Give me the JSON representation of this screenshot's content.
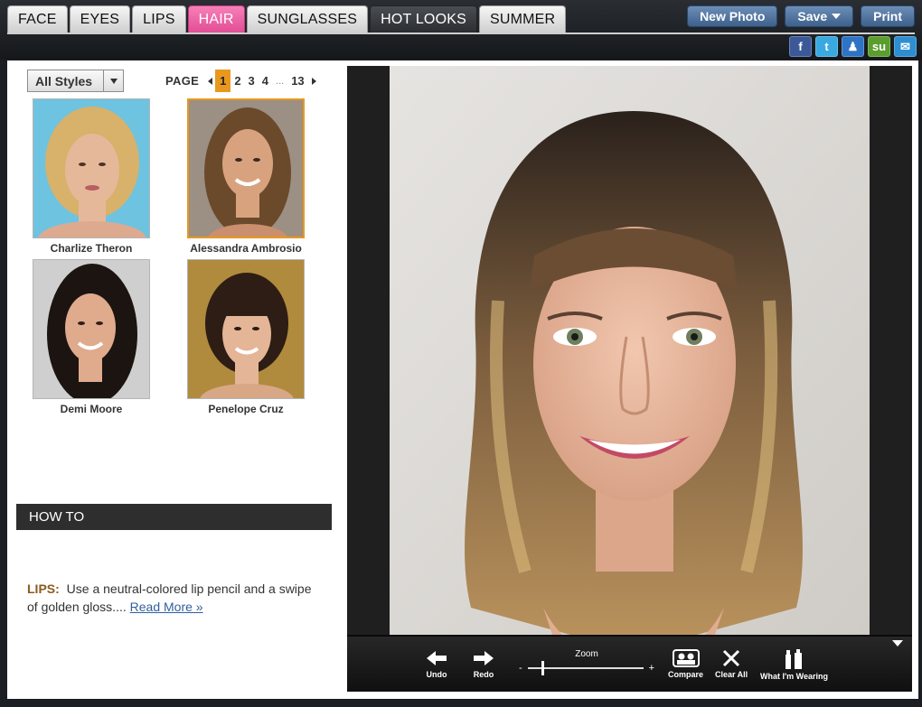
{
  "tabs": [
    {
      "label": "FACE",
      "state": "normal"
    },
    {
      "label": "EYES",
      "state": "normal"
    },
    {
      "label": "LIPS",
      "state": "normal"
    },
    {
      "label": "HAIR",
      "state": "active"
    },
    {
      "label": "SUNGLASSES",
      "state": "normal"
    },
    {
      "label": "HOT LOOKS",
      "state": "dark"
    },
    {
      "label": "SUMMER",
      "state": "normal"
    }
  ],
  "actions": {
    "new_photo": "New Photo",
    "save": "Save",
    "print": "Print"
  },
  "social": [
    {
      "icon": "facebook-icon",
      "glyph": "f",
      "color": "#3b5998"
    },
    {
      "icon": "twitter-icon",
      "glyph": "t",
      "color": "#39a9e0"
    },
    {
      "icon": "myspace-icon",
      "glyph": "♟",
      "color": "#2f74c4"
    },
    {
      "icon": "stumbleupon-icon",
      "glyph": "su",
      "color": "#5a9e2e"
    },
    {
      "icon": "email-icon",
      "glyph": "✉",
      "color": "#2e8ed1"
    }
  ],
  "filter": {
    "selected": "All Styles"
  },
  "pager": {
    "label": "PAGE",
    "pages": [
      "1",
      "2",
      "3",
      "4"
    ],
    "dots": "...",
    "last": "13",
    "current": "1"
  },
  "celebrities": [
    {
      "name": "Charlize Theron",
      "selected": false,
      "bg": "#6ec3e0",
      "hair": "#d8b16a",
      "skin": "#e6b89a"
    },
    {
      "name": "Alessandra Ambrosio",
      "selected": true,
      "bg": "#9c8f83",
      "hair": "#6b4a2c",
      "skin": "#d9a27f"
    },
    {
      "name": "Demi Moore",
      "selected": false,
      "bg": "#cfcfcf",
      "hair": "#1b1411",
      "skin": "#e0aa8d"
    },
    {
      "name": "Penelope Cruz",
      "selected": false,
      "bg": "#b08a3d",
      "hair": "#2d1d14",
      "skin": "#e4b596"
    }
  ],
  "howto": {
    "title": "HOW TO",
    "tip_key": "LIPS:",
    "tip_text": "Use a neutral-colored lip pencil and a swipe of golden gloss....",
    "read_more": "Read More »"
  },
  "toolbar": {
    "undo": "Undo",
    "redo": "Redo",
    "zoom_label": "Zoom",
    "zoom_minus": "-",
    "zoom_plus": "+",
    "zoom_level": 0.12,
    "compare": "Compare",
    "clear_all": "Clear All",
    "what_wearing": "What I'm Wearing"
  },
  "colors": {
    "hair_tab_accent": "#e24d95",
    "selected_border": "#e8981f",
    "button_blue": "#3e618b"
  }
}
